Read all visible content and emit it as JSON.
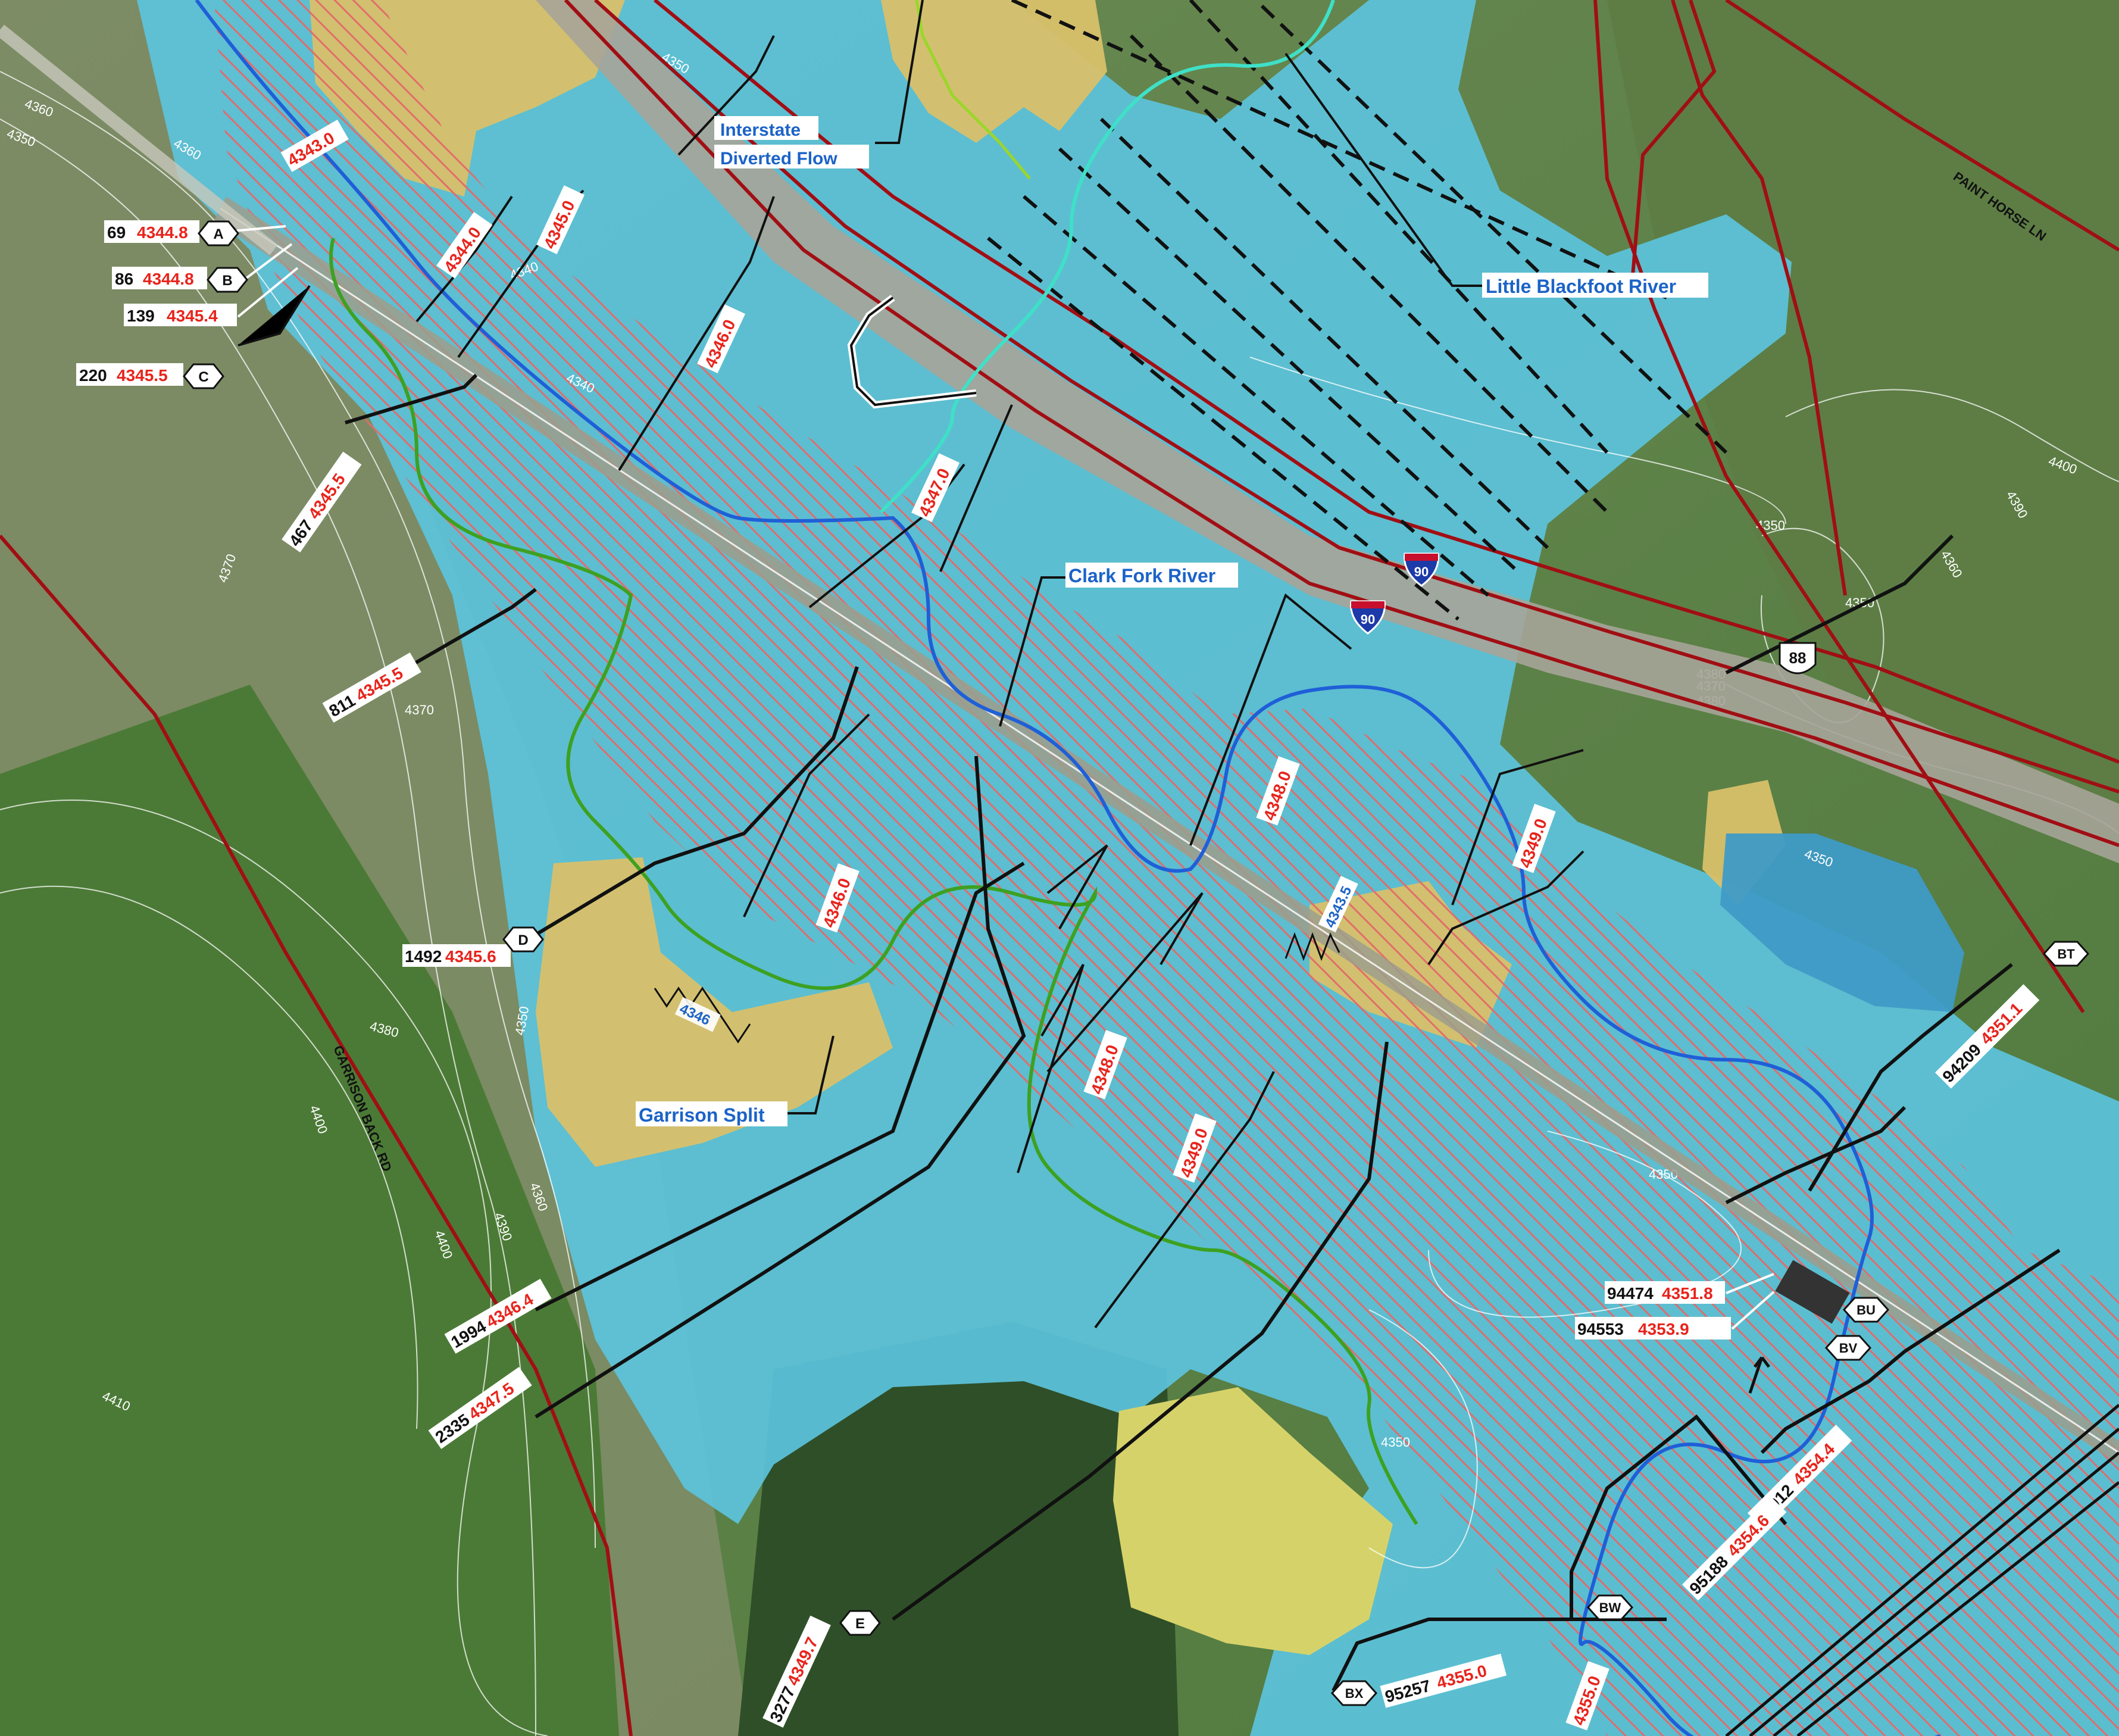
{
  "colors": {
    "floodplain": "#5cc3dc",
    "sandbar": "#d8c06a",
    "hatch": "#e36a6a",
    "river": "#1f5fd8",
    "green_channel": "#3da121",
    "cyan_channel": "#3fe0c8",
    "highway": "#a10e14"
  },
  "features": {
    "rivers": {
      "clark_fork": "Clark Fork River",
      "little_blackfoot": "Little Blackfoot River",
      "interstate_flow_line1": "Interstate",
      "interstate_flow_line2": "Diverted Flow",
      "garrison_split": "Garrison Split"
    },
    "roads": {
      "paint_horse": "PAINT HORSE LN",
      "garrison_back": "GARRISON BACK RD",
      "i90_a": "90",
      "i90_b": "90",
      "us88": "88"
    }
  },
  "stations": [
    {
      "sta": "69",
      "wse": "4344.8",
      "id": "A"
    },
    {
      "sta": "86",
      "wse": "4344.8",
      "id": "B"
    },
    {
      "sta": "139",
      "wse": "4345.4",
      "id": ""
    },
    {
      "sta": "220",
      "wse": "4345.5",
      "id": "C"
    },
    {
      "sta": "467",
      "wse": "4345.5",
      "id": ""
    },
    {
      "sta": "811",
      "wse": "4345.5",
      "id": ""
    },
    {
      "sta": "1492",
      "wse": "4345.6",
      "id": "D"
    },
    {
      "sta": "1994",
      "wse": "4346.4",
      "id": ""
    },
    {
      "sta": "2335",
      "wse": "4347.5",
      "id": ""
    },
    {
      "sta": "3277",
      "wse": "4349.7",
      "id": "E"
    },
    {
      "sta": "94209",
      "wse": "4351.1",
      "id": "BT"
    },
    {
      "sta": "94474",
      "wse": "4351.8",
      "id": "BU"
    },
    {
      "sta": "94553",
      "wse": "4353.9",
      "id": "BV"
    },
    {
      "sta": "94912",
      "wse": "4354.4",
      "id": ""
    },
    {
      "sta": "95188",
      "wse": "4354.6",
      "id": "BW"
    },
    {
      "sta": "95257",
      "wse": "4355.0",
      "id": "BX"
    }
  ],
  "bfe": [
    "4343.0",
    "4344.0",
    "4345.0",
    "4346.0",
    "4347.0",
    "4346.0",
    "4348.0",
    "4348.0",
    "4349.0",
    "4349.0",
    "4355.0"
  ],
  "bfe_blue": [
    "4343.5",
    "4346"
  ],
  "contours": [
    "4360",
    "4350",
    "4360",
    "4350",
    "4340",
    "4340",
    "4370",
    "4370",
    "4380",
    "4350",
    "4360",
    "4390",
    "4400",
    "4400",
    "4410",
    "4350",
    "4350",
    "4380",
    "4370",
    "4380",
    "4400",
    "4390",
    "4360",
    "4350",
    "4350",
    "4350"
  ]
}
